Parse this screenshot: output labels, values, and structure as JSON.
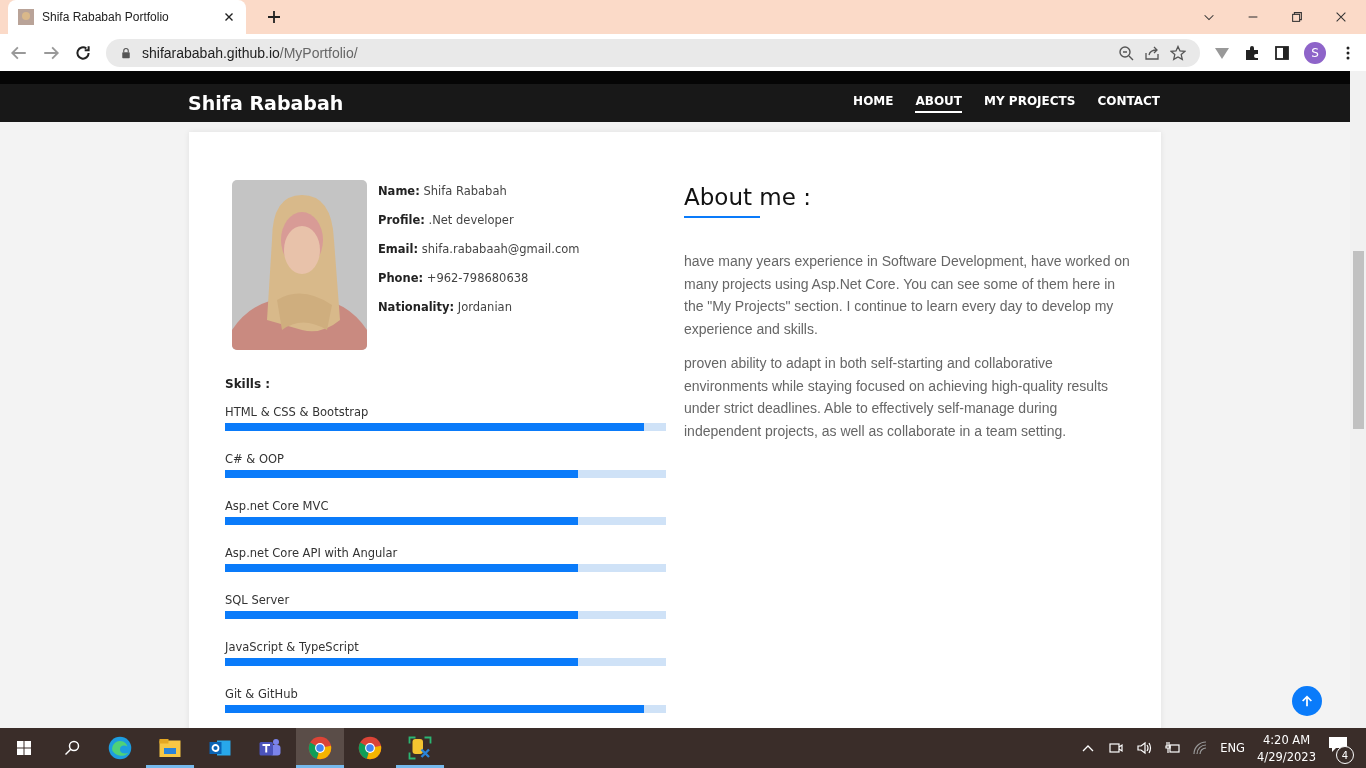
{
  "browser": {
    "tab_title": "Shifa Rababah Portfolio",
    "url": {
      "host": "shifarababah.github.io",
      "path": "/MyPortfolio/"
    },
    "profile_initial": "S"
  },
  "navbar": {
    "brand": "Shifa Rababah",
    "links": [
      {
        "label": "HOME",
        "selected": false
      },
      {
        "label": "ABOUT",
        "selected": true
      },
      {
        "label": "MY PROJECTS",
        "selected": false
      },
      {
        "label": "CONTACT",
        "selected": false
      }
    ]
  },
  "profile": {
    "details": [
      {
        "label": "Name:",
        "value": "Shifa Rababah"
      },
      {
        "label": "Profile:",
        "value": ".Net developer"
      },
      {
        "label": "Email:",
        "value": "shifa.rababaah@gmail.com"
      },
      {
        "label": "Phone:",
        "value": "+962-798680638"
      },
      {
        "label": "Nationality:",
        "value": "Jordanian"
      }
    ]
  },
  "skills": {
    "title": "Skills :",
    "items": [
      {
        "name": "HTML & CSS & Bootstrap",
        "level": 0.95
      },
      {
        "name": "C# & OOP",
        "level": 0.8
      },
      {
        "name": "Asp.net Core MVC",
        "level": 0.8
      },
      {
        "name": "Asp.net Core API with Angular",
        "level": 0.8
      },
      {
        "name": "SQL Server",
        "level": 0.8
      },
      {
        "name": "JavaScript & TypeScript",
        "level": 0.8
      },
      {
        "name": "Git & GitHub",
        "level": 0.95
      }
    ]
  },
  "about": {
    "title": "About me :",
    "paragraphs": [
      "have many years experience in Software Development, have worked on many projects using Asp.Net Core. You can see some of them here in the \"My Projects\" section. I continue to learn every day to develop my experience and skills.",
      "proven ability to adapt in both self-starting and collaborative environments while staying focused on achieving high-quality results under strict deadlines. Able to effectively self-manage during independent projects, as well as collaborate in a team setting."
    ]
  },
  "taskbar": {
    "apps": [
      {
        "kind": "start",
        "running": false,
        "selected": false
      },
      {
        "kind": "search",
        "running": false,
        "selected": false
      },
      {
        "kind": "edge",
        "running": false,
        "selected": false
      },
      {
        "kind": "folder",
        "running": true,
        "selected": false
      },
      {
        "kind": "mail",
        "running": false,
        "selected": false
      },
      {
        "kind": "teams",
        "running": false,
        "selected": false
      },
      {
        "kind": "chrome",
        "running": true,
        "selected": true
      },
      {
        "kind": "chrome",
        "running": false,
        "selected": false
      },
      {
        "kind": "tool",
        "running": true,
        "selected": false
      }
    ],
    "language": "ENG",
    "time": "4:20 AM",
    "date": "4/29/2023",
    "notifications": "4"
  }
}
